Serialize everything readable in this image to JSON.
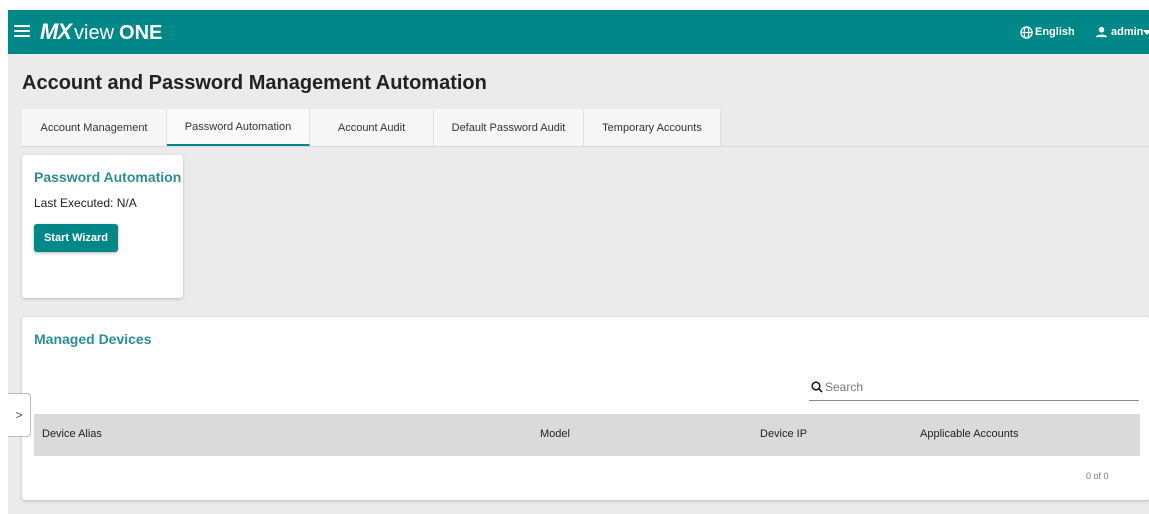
{
  "header": {
    "logo_mx": "MX",
    "logo_view": "view",
    "logo_one": "ONE",
    "language": "English",
    "user": "admin",
    "bar_color": "#008787"
  },
  "page": {
    "title": "Account and Password Management Automation"
  },
  "tabs": [
    {
      "label": "Account Management",
      "active": false
    },
    {
      "label": "Password Automation",
      "active": true
    },
    {
      "label": "Account Audit",
      "active": false
    },
    {
      "label": "Default Password Audit",
      "active": false
    },
    {
      "label": "Temporary Accounts",
      "active": false
    }
  ],
  "password_automation": {
    "title": "Password Automation",
    "last_executed": "Last Executed: N/A",
    "start_button": "Start Wizard"
  },
  "managed_devices": {
    "title": "Managed Devices",
    "search_placeholder": "Search",
    "columns": [
      "Device Alias",
      "Model",
      "Device IP",
      "Applicable Accounts"
    ],
    "rows": [],
    "pagination": "0 of 0"
  },
  "side_toggle": ">"
}
